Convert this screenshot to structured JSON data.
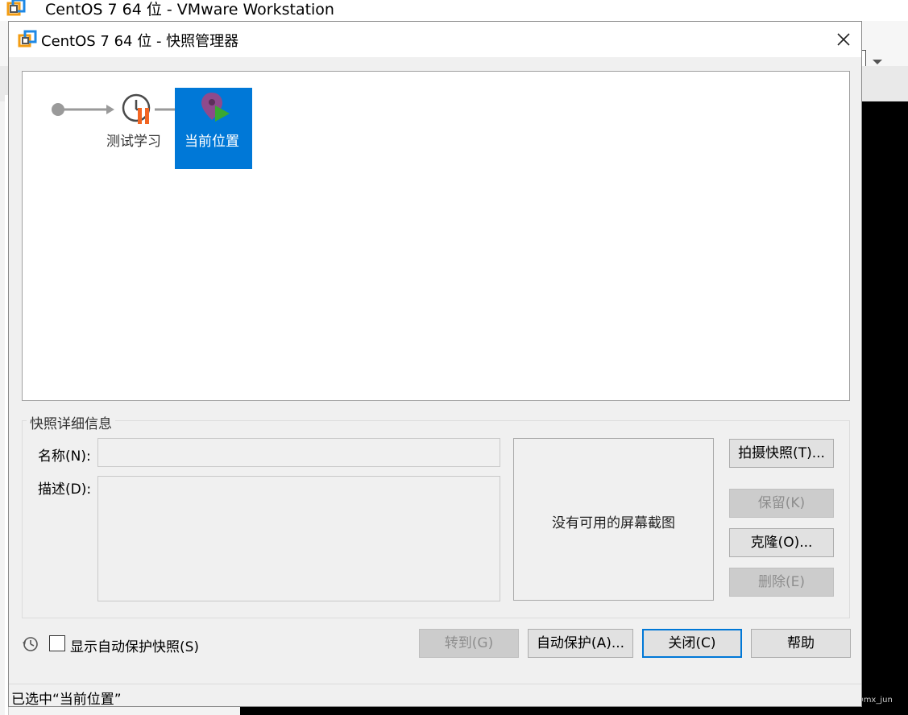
{
  "background_window": {
    "title": "CentOS 7 64 位 - VMware Workstation",
    "watermark": "CSDN @mx_jun"
  },
  "dialog": {
    "title": "CentOS 7 64 位 - 快照管理器",
    "tree": {
      "snapshot_label": "测试学习",
      "current_label": "当前位置"
    },
    "details": {
      "group_title": "快照详细信息",
      "name_label": "名称(N):",
      "name_value": "",
      "desc_label": "描述(D):",
      "desc_value": "",
      "screenshot_placeholder": "没有可用的屏幕截图"
    },
    "side_buttons": {
      "take_snapshot": "拍摄快照(T)...",
      "keep": "保留(K)",
      "clone": "克隆(O)...",
      "delete": "删除(E)"
    },
    "bottom": {
      "show_autoprotect_label": "显示自动保护快照(S)",
      "show_autoprotect_checked": false,
      "goto": "转到(G)",
      "autoprotect": "自动保护(A)...",
      "close": "关闭(C)",
      "help": "帮助"
    },
    "status": "已选中“当前位置”"
  },
  "colors": {
    "selection": "#0078d7",
    "snapshot_orange": "#f26522",
    "current_green": "#3aa832",
    "current_purple": "#8e4a8c"
  }
}
